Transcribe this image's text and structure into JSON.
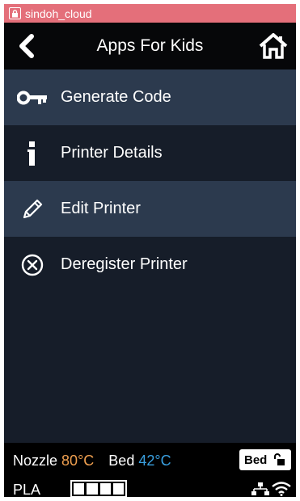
{
  "topbar": {
    "account": "sindoh_cloud"
  },
  "header": {
    "title": "Apps For Kids"
  },
  "menu": {
    "items": [
      {
        "label": "Generate Code",
        "icon": "key-icon",
        "highlighted": true
      },
      {
        "label": "Printer Details",
        "icon": "info-icon",
        "highlighted": false
      },
      {
        "label": "Edit Printer",
        "icon": "pencil-icon",
        "highlighted": true
      },
      {
        "label": "Deregister Printer",
        "icon": "circle-x-icon",
        "highlighted": false
      }
    ]
  },
  "status": {
    "nozzle_label": "Nozzle",
    "nozzle_temp": "80°C",
    "bed_label": "Bed",
    "bed_temp": "42°C",
    "bed_button": "Bed",
    "material": "PLA",
    "battery_cells": 4
  },
  "colors": {
    "topbar": "#e46f7a",
    "background": "#161d29",
    "highlight": "#2c3a4e",
    "nozzle_temp": "#f0a050",
    "bed_temp": "#3aa0e0"
  }
}
